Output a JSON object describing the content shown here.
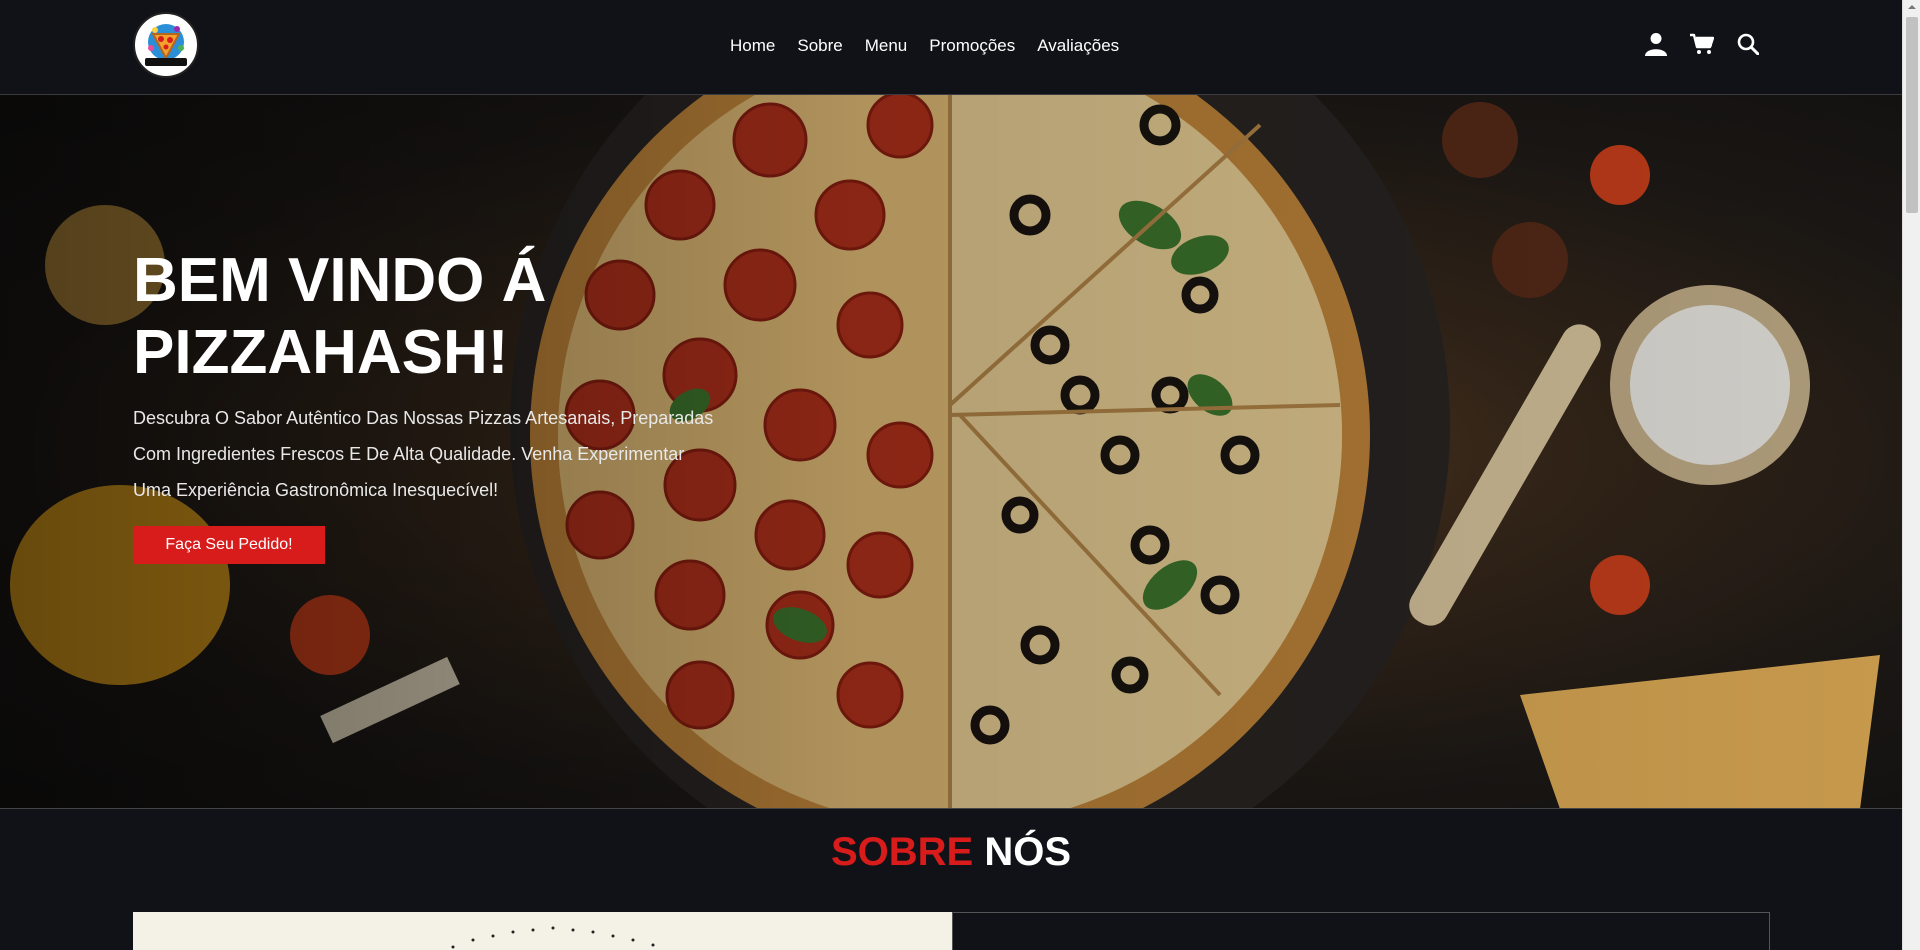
{
  "brand": {
    "logo_text": "PIZZAHASH",
    "accent": "#d81c1c",
    "background": "#111217"
  },
  "nav": {
    "items": [
      "Home",
      "Sobre",
      "Menu",
      "Promoções",
      "Avaliações"
    ]
  },
  "header_icons": [
    "user-icon",
    "cart-icon",
    "search-icon"
  ],
  "hero": {
    "title": "BEM VINDO Á PIZZAHASH!",
    "text": "Descubra O Sabor Autêntico Das Nossas Pizzas Artesanais, Preparadas Com Ingredientes Frescos E De Alta Qualidade. Venha Experimentar Uma Experiência Gastronômica Inesquecível!",
    "button_label": "Faça Seu Pedido!"
  },
  "about": {
    "title_red": "SOBRE",
    "title_white": "NÓS"
  }
}
